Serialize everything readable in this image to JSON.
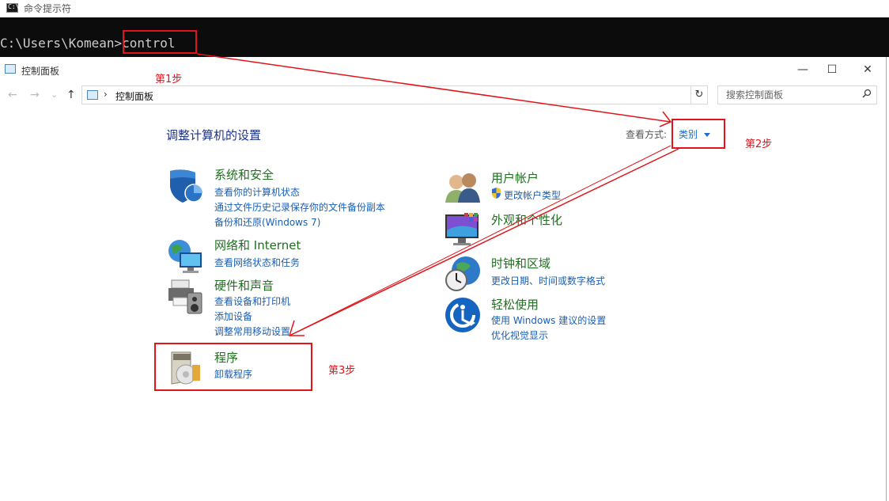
{
  "cmd": {
    "title": "命令提示符",
    "icon": "cmd-icon",
    "prompt": "C:\\Users\\Komean>",
    "command": "control"
  },
  "window": {
    "title": "控制面板",
    "controls": [
      "minimize-icon",
      "maximize-icon",
      "close-icon"
    ],
    "minimize": "—",
    "maximize": "☐",
    "close": "✕"
  },
  "nav": {
    "back": "←",
    "forward": "→",
    "recent": "⌄",
    "up": "↑",
    "breadcrumb_sep": "›",
    "breadcrumb": "控制面板",
    "refresh": "↻",
    "search_placeholder": "搜索控制面板"
  },
  "content": {
    "heading": "调整计算机的设置",
    "view_by_label": "查看方式:",
    "view_by_value": "类别"
  },
  "categories": {
    "system": {
      "title": "系统和安全",
      "icon": "shield-icon",
      "links": [
        "查看你的计算机状态",
        "通过文件历史记录保存你的文件备份副本",
        "备份和还原(Windows 7)"
      ]
    },
    "network": {
      "title": "网络和 Internet",
      "icon": "network-globe-icon",
      "links": [
        "查看网络状态和任务"
      ]
    },
    "hardware": {
      "title": "硬件和声音",
      "icon": "printer-speaker-icon",
      "links": [
        "查看设备和打印机",
        "添加设备",
        "调整常用移动设置"
      ]
    },
    "programs": {
      "title": "程序",
      "icon": "programs-disc-icon",
      "links": [
        "卸载程序"
      ]
    },
    "users": {
      "title": "用户帐户",
      "icon": "users-icon",
      "links": [
        "更改帐户类型"
      ]
    },
    "appearance": {
      "title": "外观和个性化",
      "icon": "monitor-palette-icon",
      "links": []
    },
    "clock": {
      "title": "时钟和区域",
      "icon": "clock-globe-icon",
      "links": [
        "更改日期、时间或数字格式"
      ]
    },
    "ease": {
      "title": "轻松使用",
      "icon": "ease-of-access-icon",
      "links": [
        "使用 Windows 建议的设置",
        "优化视觉显示"
      ]
    }
  },
  "annotations": {
    "step1": "第1步",
    "step2": "第2步",
    "step3": "第3步",
    "color": "#e1141b"
  }
}
